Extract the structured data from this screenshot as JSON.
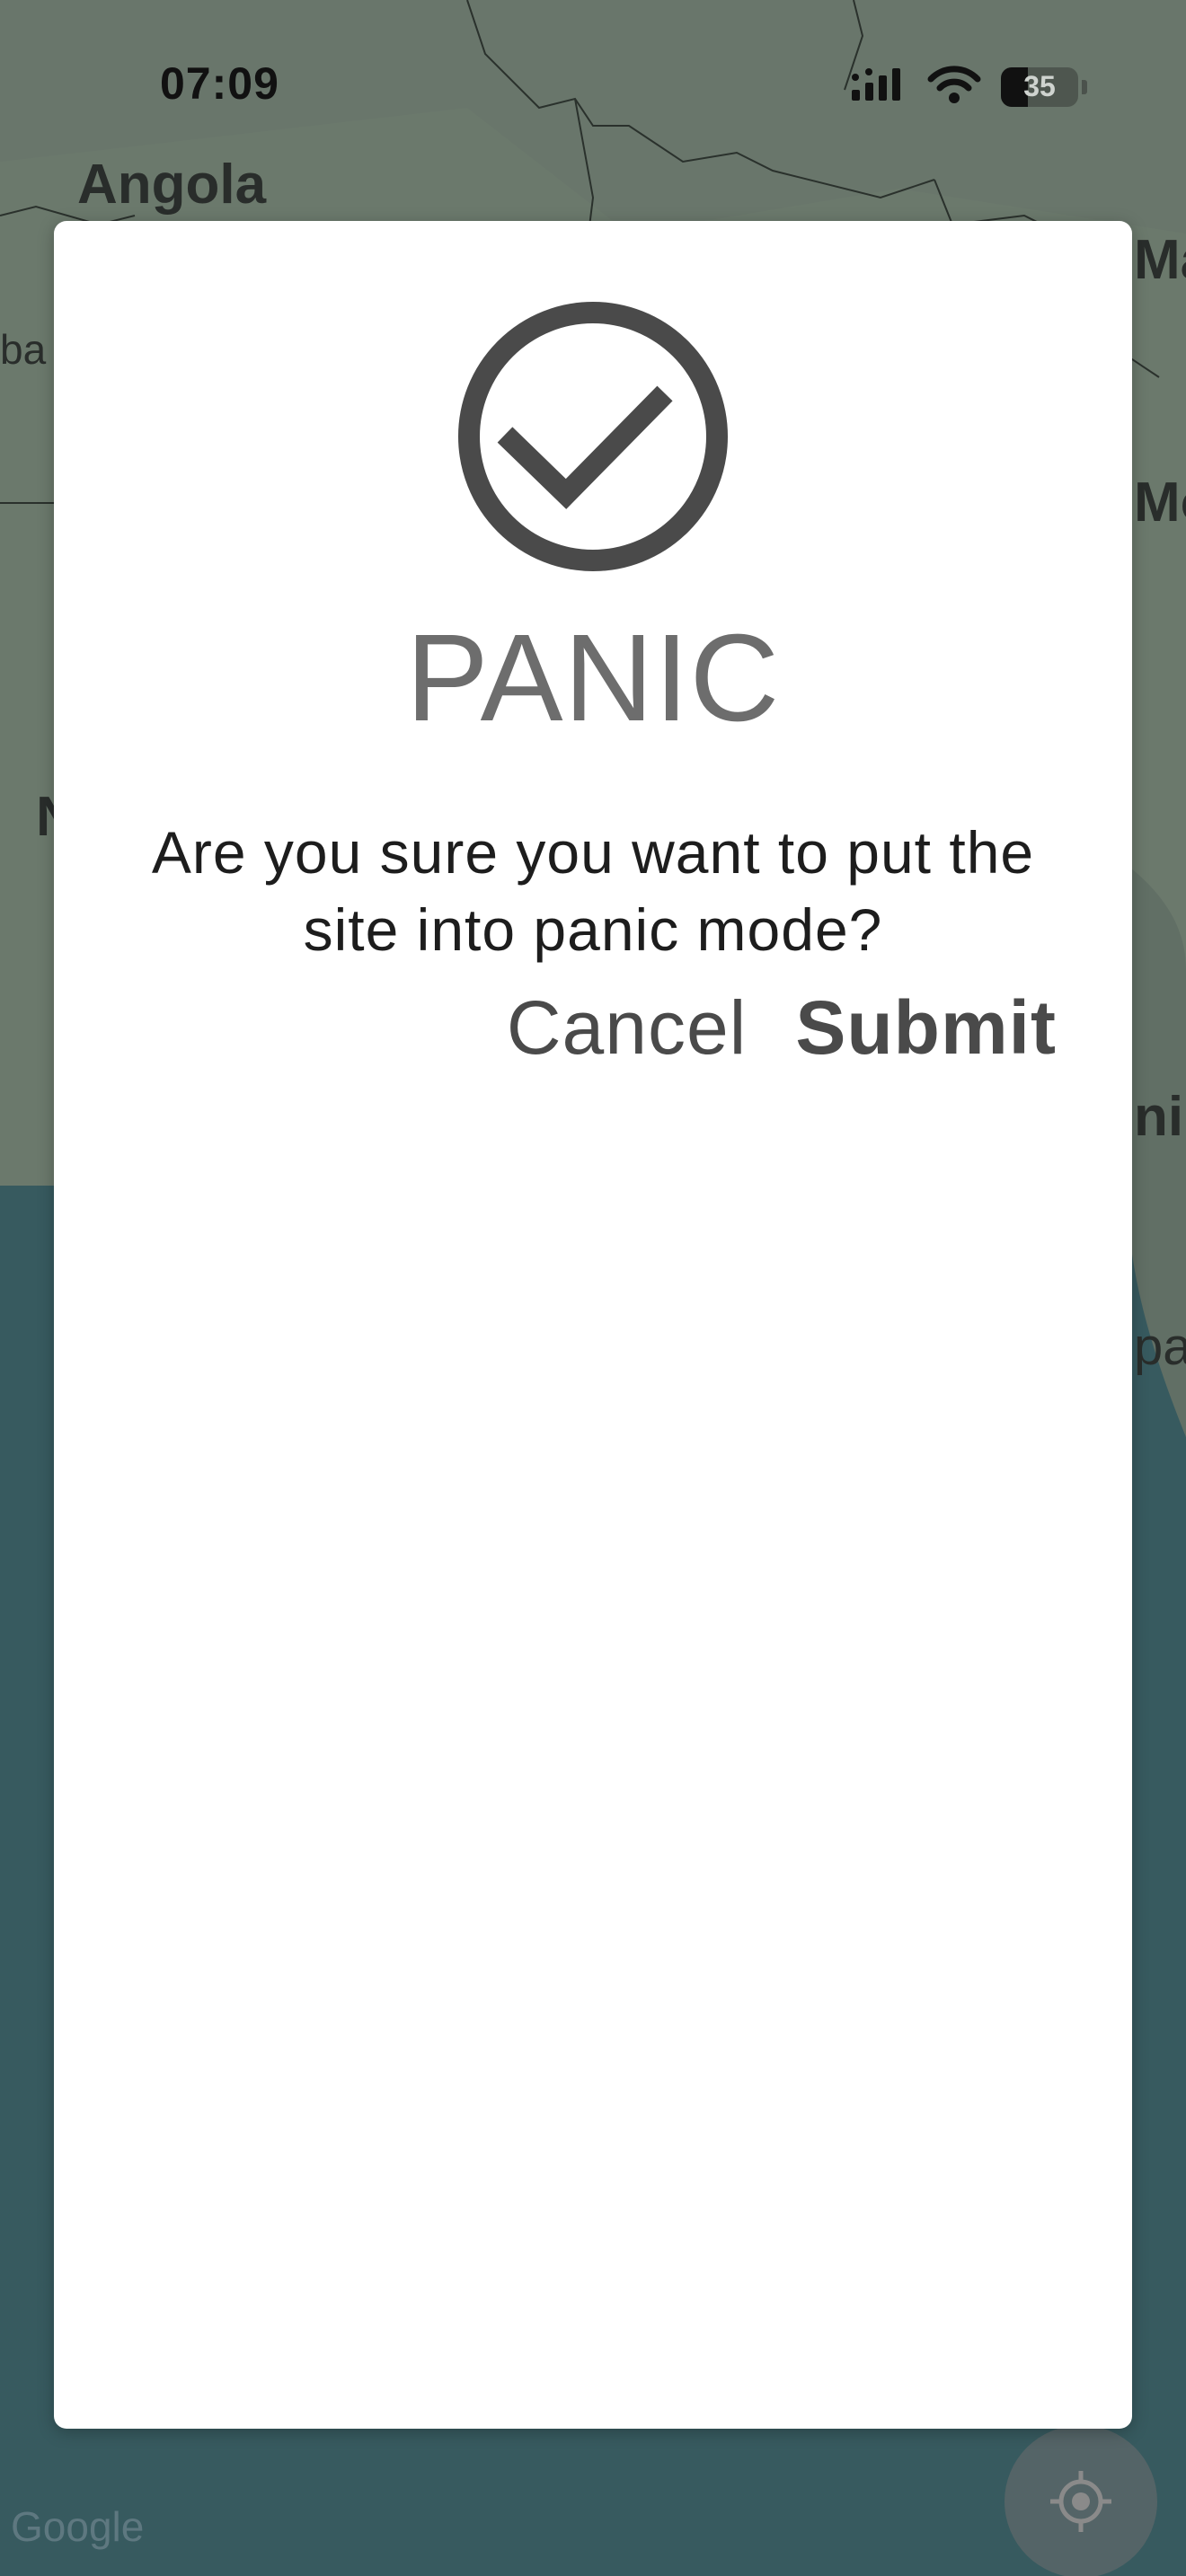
{
  "status_bar": {
    "time": "07:09",
    "battery_level": "35",
    "battery_fraction": 0.35
  },
  "map": {
    "labels": [
      "Angola",
      "Ma",
      "ba",
      "Mo",
      "N",
      "ni",
      "pa"
    ],
    "attribution": "Google",
    "colors": {
      "land": "#8aa08e",
      "water": "#2f6b74",
      "border": "#1e2a22"
    }
  },
  "dialog": {
    "icon": "check-circle-icon",
    "title": "PANIC",
    "message": "Are you sure you want to put the site into panic mode?",
    "cancel_label": "Cancel",
    "submit_label": "Submit",
    "colors": {
      "icon": "#4a4a4a",
      "title": "#6d6d6d",
      "background": "#ffffff"
    }
  }
}
